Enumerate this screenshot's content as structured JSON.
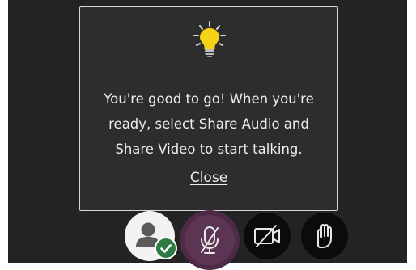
{
  "popup": {
    "icon": "lightbulb-icon",
    "message_lines": [
      "You're good to go! When you're",
      "ready, select Share Audio and",
      "Share Video to start talking."
    ],
    "close_label": "Close"
  },
  "controls": [
    {
      "name": "profile",
      "icon": "user-avatar-icon",
      "status_badge": "checkmark-icon"
    },
    {
      "name": "share-audio",
      "icon": "microphone-muted-icon"
    },
    {
      "name": "share-video",
      "icon": "camera-off-icon"
    },
    {
      "name": "raise-hand",
      "icon": "hand-icon"
    }
  ],
  "colors": {
    "background": "#232323",
    "popup": "#2d2d2d",
    "mic_active": "#5c3553",
    "status_ok": "#2f7a43"
  }
}
